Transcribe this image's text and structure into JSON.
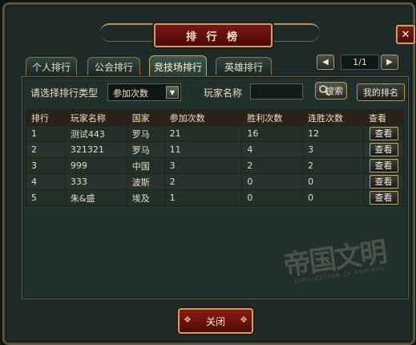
{
  "window": {
    "title": "排 行 榜",
    "close_symbol": "✕"
  },
  "tabs": [
    {
      "label": "个人排行",
      "active": false
    },
    {
      "label": "公会排行",
      "active": false
    },
    {
      "label": "竞技场排行",
      "active": true
    },
    {
      "label": "英雄排行",
      "active": false
    }
  ],
  "pager": {
    "prev_symbol": "◀",
    "next_symbol": "▶",
    "text": "1/1"
  },
  "filter": {
    "type_label": "请选择排行类型",
    "type_value": "参加次数",
    "name_label": "玩家名称",
    "name_value": "",
    "search_label": "搜索",
    "my_rank_label": "我的排名"
  },
  "table": {
    "headers": [
      "排行",
      "玩家名称",
      "国家",
      "参加次数",
      "胜利次数",
      "连胜次数",
      "查看"
    ],
    "rows": [
      {
        "rank": "1",
        "name": "测试443",
        "country": "罗马",
        "join": "21",
        "wins": "16",
        "streak": "12",
        "view": "查看"
      },
      {
        "rank": "2",
        "name": "321321",
        "country": "罗马",
        "join": "11",
        "wins": "4",
        "streak": "3",
        "view": "查看"
      },
      {
        "rank": "3",
        "name": "999",
        "country": "中国",
        "join": "3",
        "wins": "2",
        "streak": "2",
        "view": "查看"
      },
      {
        "rank": "4",
        "name": "333",
        "country": "波斯",
        "join": "2",
        "wins": "0",
        "streak": "0",
        "view": "查看"
      },
      {
        "rank": "5",
        "name": "朱&盛",
        "country": "埃及",
        "join": "1",
        "wins": "0",
        "streak": "0",
        "view": "查看"
      }
    ]
  },
  "watermark": {
    "main": "帝国文明",
    "sub": "CIVILIZATION OF EMPIRES"
  },
  "footer": {
    "close_label": "关闭"
  },
  "colors": {
    "accent_gold": "#c7a363",
    "title_red": "#6b1212",
    "panel_bg": "#22302d"
  }
}
